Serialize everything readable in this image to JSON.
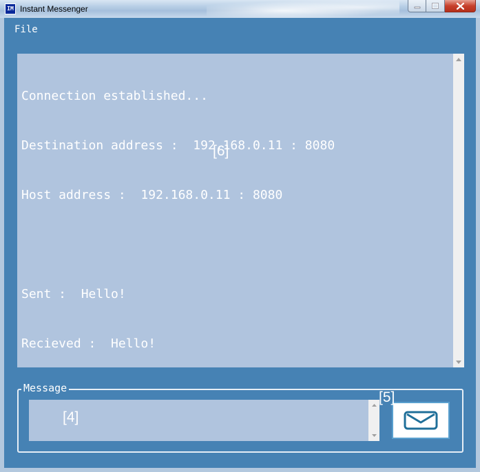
{
  "window": {
    "title": "Instant Messenger",
    "icon_text": "IM",
    "icon": "app-im-icon",
    "controls": [
      "minimize-icon",
      "maximize-icon",
      "close-icon"
    ]
  },
  "menu": {
    "items": [
      {
        "label": "File"
      }
    ]
  },
  "chat_log": {
    "lines": [
      "Connection established...",
      "Destination address :  192.168.0.11 : 8080",
      "Host address :  192.168.0.11 : 8080",
      "",
      "Sent :  Hello!",
      "Recieved :  Hello!"
    ],
    "annotation": "[6]"
  },
  "message_group": {
    "legend": "Message",
    "input_value": "",
    "input_annotation": "[4]",
    "send_annotation": "[5]",
    "send_icon": "envelope-icon"
  },
  "colors": {
    "client_bg": "#4682b4",
    "textbox_bg": "#b0c4de",
    "text": "#ffffff",
    "send_border": "#5aa0cf"
  }
}
